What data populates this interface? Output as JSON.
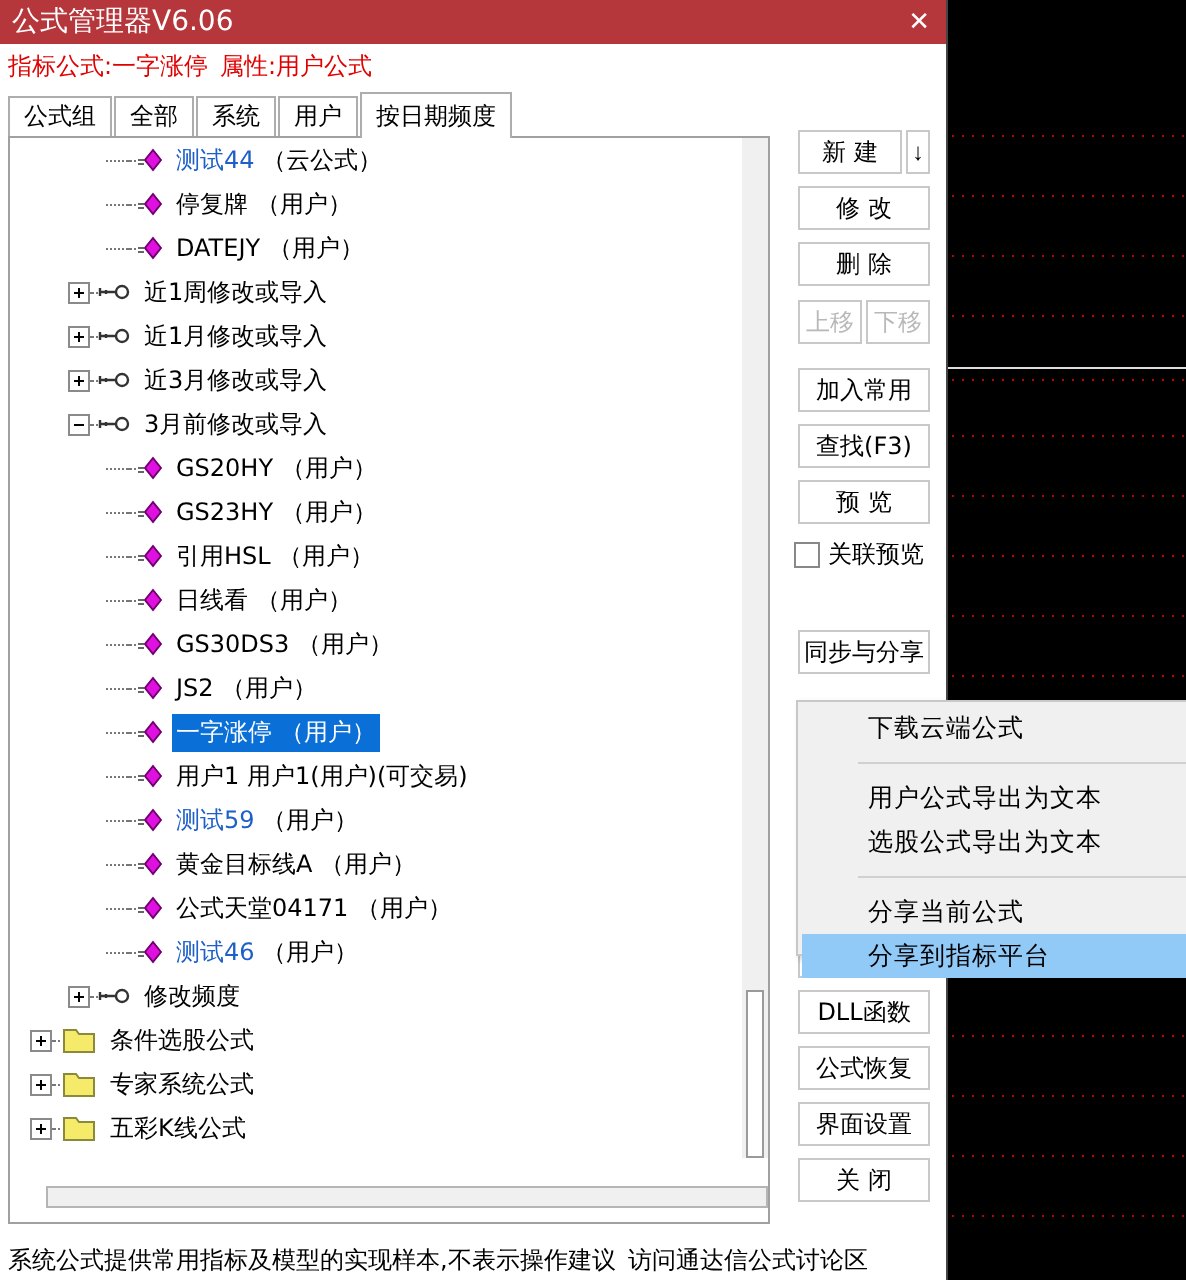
{
  "window": {
    "title": "公式管理器V6.06",
    "close": "✕"
  },
  "info": {
    "formula_label": "指标公式:",
    "formula": "一字涨停",
    "attr_label": "属性:",
    "attr": "用户公式"
  },
  "tabs": [
    {
      "label": "公式组",
      "selected": false
    },
    {
      "label": "全部",
      "selected": false
    },
    {
      "label": "系统",
      "selected": false
    },
    {
      "label": "用户",
      "selected": false
    },
    {
      "label": "按日期频度",
      "selected": true
    }
  ],
  "tree": [
    {
      "children": [
        {
          "children": [
            {
              "kind": "formula",
              "name": "测试44",
              "note": "（云公式）",
              "color": "#1e5fc8",
              "selected": false
            },
            {
              "kind": "formula",
              "name": "停复牌",
              "note": "（用户）",
              "color": "#000000",
              "selected": false
            },
            {
              "kind": "formula",
              "name": "DATEJY",
              "note": "（用户）",
              "color": "#000000",
              "selected": false
            }
          ]
        },
        {
          "kind": "group",
          "name": "近1周修改或导入",
          "expanded": false
        },
        {
          "kind": "group",
          "name": "近1月修改或导入",
          "expanded": false
        },
        {
          "kind": "group",
          "name": "近3月修改或导入",
          "expanded": false
        },
        {
          "kind": "group",
          "name": "3月前修改或导入",
          "expanded": true,
          "children": [
            {
              "kind": "formula",
              "name": "GS20HY",
              "note": "（用户）",
              "color": "#000000",
              "selected": false
            },
            {
              "kind": "formula",
              "name": "GS23HY",
              "note": "（用户）",
              "color": "#000000",
              "selected": false
            },
            {
              "kind": "formula",
              "name": "引用HSL",
              "note": "（用户）",
              "color": "#000000",
              "selected": false
            },
            {
              "kind": "formula",
              "name": "日线看",
              "note": "（用户）",
              "color": "#000000",
              "selected": false
            },
            {
              "kind": "formula",
              "name": "GS30DS3",
              "note": "（用户）",
              "color": "#000000",
              "selected": false
            },
            {
              "kind": "formula",
              "name": "JS2",
              "note": "（用户）",
              "color": "#000000",
              "selected": false
            },
            {
              "kind": "formula",
              "name": "一字涨停",
              "note": "（用户）",
              "selected": true
            },
            {
              "kind": "formula",
              "name": "用户1",
              "note": "用户1(用户)(可交易)",
              "color": "#000000",
              "selected": false
            },
            {
              "kind": "formula",
              "name": "测试59",
              "note": "（用户）",
              "color": "#1e5fc8",
              "selected": false
            },
            {
              "kind": "formula",
              "name": "黄金目标线A",
              "note": "（用户）",
              "color": "#000000",
              "selected": false
            },
            {
              "kind": "formula",
              "name": "公式天堂04171",
              "note": "（用户）",
              "color": "#000000",
              "selected": false
            },
            {
              "kind": "formula",
              "name": "测试46",
              "note": "（用户）",
              "color": "#1e5fc8",
              "selected": false
            }
          ]
        },
        {
          "kind": "group",
          "name": "修改频度",
          "expanded": false
        }
      ]
    },
    {
      "kind": "folder",
      "name": "条件选股公式",
      "expanded": false
    },
    {
      "kind": "folder",
      "name": "专家系统公式",
      "expanded": false
    },
    {
      "kind": "folder",
      "name": "五彩K线公式",
      "expanded": false
    }
  ],
  "buttons": [
    {
      "kind": "split",
      "label": "新 建",
      "arrow": "↓"
    },
    {
      "kind": "button",
      "label": "修 改"
    },
    {
      "kind": "button",
      "label": "删 除"
    },
    {
      "kind": "pair",
      "labels": [
        "上移",
        "下移"
      ],
      "disabled": true
    },
    {
      "kind": "button",
      "label": "加入常用"
    },
    {
      "kind": "button",
      "label": "查找(F3)"
    },
    {
      "kind": "button",
      "label": "预 览"
    },
    {
      "kind": "checkbox",
      "label": "关联预览",
      "checked": false
    },
    {
      "kind": "button",
      "label": "同步与分享"
    },
    {
      "kind": "covered"
    },
    {
      "kind": "button",
      "label": "DLL函数"
    },
    {
      "kind": "button",
      "label": "公式恢复"
    },
    {
      "kind": "button",
      "label": "界面设置"
    },
    {
      "kind": "button",
      "label": "关 闭"
    }
  ],
  "menu": [
    {
      "kind": "item",
      "label": "下载云端公式",
      "selected": false
    },
    {
      "kind": "separator"
    },
    {
      "kind": "item",
      "label": "用户公式导出为文本",
      "selected": false
    },
    {
      "kind": "item",
      "label": "选股公式导出为文本",
      "selected": false
    },
    {
      "kind": "separator"
    },
    {
      "kind": "item",
      "label": "分享当前公式",
      "selected": false
    },
    {
      "kind": "item",
      "label": "分享到指标平台",
      "selected": true
    }
  ],
  "status_bar": {
    "text": "系统公式提供常用指标及模型的实现样本,不表示操作建议",
    "link": "访问通达信公式讨论区"
  }
}
